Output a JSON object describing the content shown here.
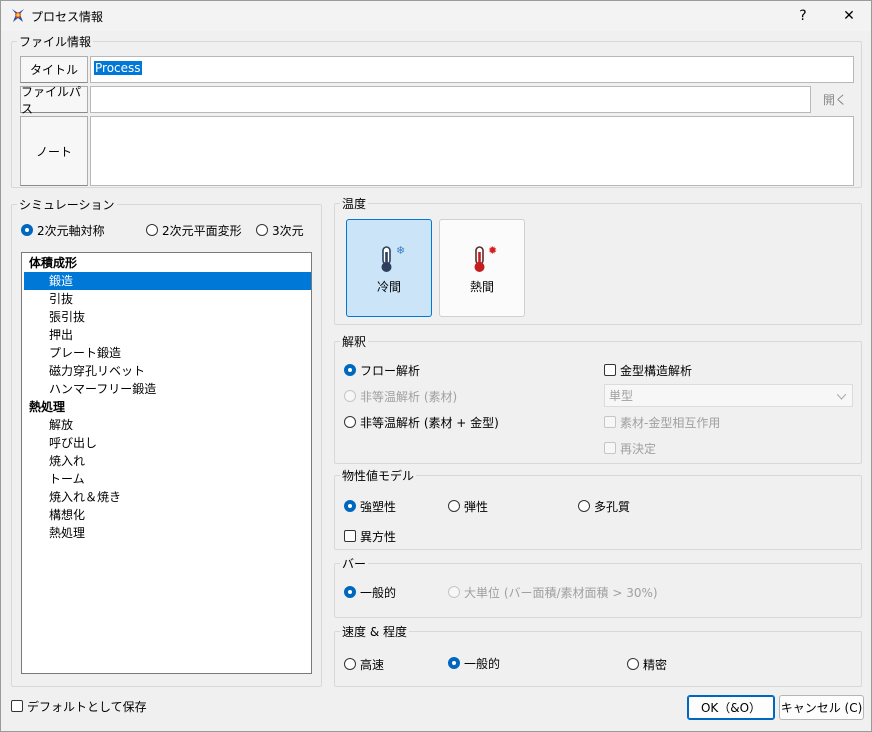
{
  "window": {
    "title": "プロセス情報",
    "help_label": "?",
    "close_label": "✕"
  },
  "file_info": {
    "label": "ファイル情報",
    "title_label": "タイトル",
    "title_value": "Process",
    "path_label": "ファイルパス",
    "path_value": "",
    "open_label": "開く",
    "note_label": "ノート",
    "note_value": ""
  },
  "simulation": {
    "label": "シミュレーション",
    "modes": [
      "2次元軸対称",
      "2次元平面変形",
      "3次元"
    ],
    "selected_mode": "2次元軸対称",
    "categories": [
      {
        "name": "体積成形",
        "items": [
          "鍛造",
          "引抜",
          "張引抜",
          "押出",
          "プレート鍛造",
          "磁力穿孔リベット",
          "ハンマーフリー鍛造"
        ]
      },
      {
        "name": "熱処理",
        "items": [
          "解放",
          "呼び出し",
          "焼入れ",
          "トーム",
          "焼入れ＆焼き",
          "構想化",
          "熱処理"
        ]
      }
    ],
    "selected_item": "鍛造"
  },
  "temperature": {
    "label": "温度",
    "options": [
      {
        "label": "冷間",
        "icon": "thermometer-cold-icon",
        "active": true
      },
      {
        "label": "熱間",
        "icon": "thermometer-hot-icon",
        "active": false
      }
    ]
  },
  "analysis": {
    "label": "解釈",
    "flow": "フロー解析",
    "noniso_material": "非等温解析 (素材)",
    "noniso_material_die": "非等温解析 (素材 + 金型)",
    "die_structure": "金型構造解析",
    "die_combo": "単型",
    "interaction": "素材-金型相互作用",
    "redetermine": "再決定"
  },
  "material_model": {
    "label": "物性値モデル",
    "options": [
      "強塑性",
      "弾性",
      "多孔質"
    ],
    "selected": "強塑性",
    "anisotropy": "異方性"
  },
  "bar": {
    "label": "バー",
    "general": "一般的",
    "large_unit": "大単位 (バー面積/素材面積 > 30%)"
  },
  "speed": {
    "label": "速度 & 程度",
    "options": [
      "高速",
      "一般的",
      "精密"
    ],
    "selected": "一般的"
  },
  "footer": {
    "save_default": "デフォルトとして保存",
    "ok": "OK（&O）",
    "cancel": "キャンセル (C)"
  },
  "colors": {
    "accent": "#0078d7",
    "selection": "#0078d7",
    "cold": "#3b6ea5",
    "hot": "#d62020"
  }
}
